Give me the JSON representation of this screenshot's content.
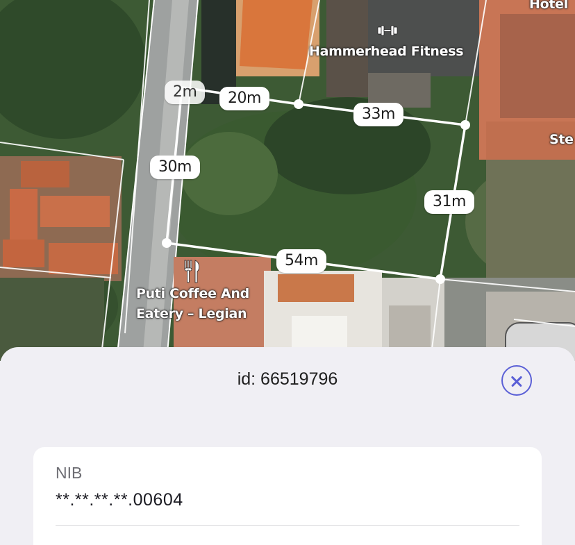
{
  "map": {
    "measurements": [
      "2m",
      "20m",
      "33m",
      "30m",
      "31m",
      "54m"
    ],
    "pois": {
      "fitness": {
        "name": "Hammerhead Fitness",
        "icon": "dumbbell-icon"
      },
      "cafe": {
        "line1": "Puti Coffee And",
        "line2": "Eatery – Legian",
        "icon": "fork-knife-icon"
      },
      "hotel": {
        "name": "Hotel"
      },
      "street": {
        "name": "Ste"
      }
    }
  },
  "sheet": {
    "title": "id: 66519796",
    "close_icon": "close-circle-icon",
    "accent_color": "#5a5fd6",
    "fields": [
      {
        "label": "NIB",
        "value": "**.**.**.**.00604"
      }
    ]
  }
}
